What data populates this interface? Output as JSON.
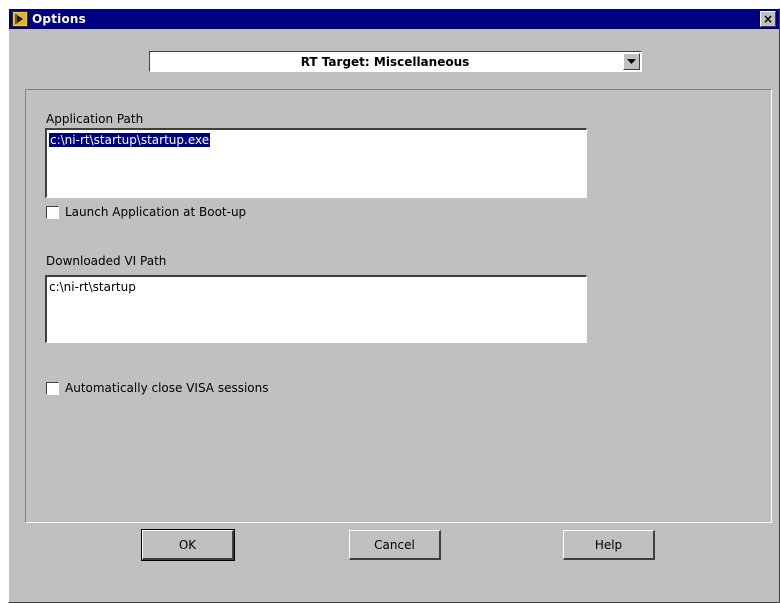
{
  "window": {
    "title": "Options"
  },
  "category": {
    "selected": "RT Target: Miscellaneous"
  },
  "application_path": {
    "label": "Application Path",
    "value": "c:\\ni-rt\\startup\\startup.exe"
  },
  "launch_at_boot": {
    "label": "Launch Application at Boot-up",
    "checked": false
  },
  "downloaded_vi_path": {
    "label": "Downloaded VI Path",
    "value": "c:\\ni-rt\\startup"
  },
  "close_visa": {
    "label": "Automatically close VISA sessions",
    "checked": false
  },
  "buttons": {
    "ok": "OK",
    "cancel": "Cancel",
    "help": "Help"
  },
  "colors": {
    "titlebar": "#000080",
    "face": "#c0c0c0",
    "selection": "#000080"
  },
  "icons": {
    "app": "labview-app-icon",
    "close": "close-icon",
    "dropdown": "chevron-down-icon"
  }
}
